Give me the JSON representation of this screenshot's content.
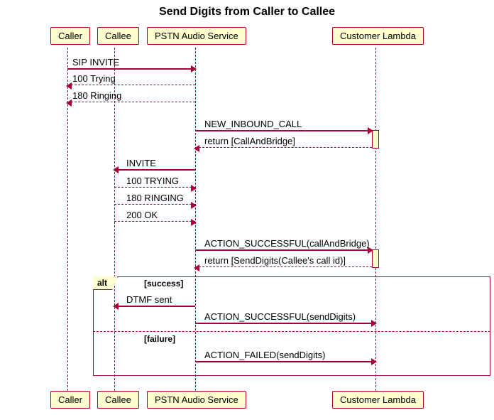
{
  "title": "Send Digits from Caller to Callee",
  "participants": {
    "caller": "Caller",
    "callee": "Callee",
    "pstn": "PSTN Audio Service",
    "lambda": "Customer Lambda"
  },
  "messages": {
    "m1": "SIP INVITE",
    "m2": "100 Trying",
    "m3": "180 Ringing",
    "m4": "NEW_INBOUND_CALL",
    "m5": "return [CallAndBridge]",
    "m6": "INVITE",
    "m7": "100 TRYING",
    "m8": "180 RINGING",
    "m9": "200 OK",
    "m10": "ACTION_SUCCESSFUL(callAndBridge)",
    "m11": "return [SendDigits(Callee's call id)]",
    "m12": "DTMF sent",
    "m13": "ACTION_SUCCESSFUL(sendDigits)",
    "m14": "ACTION_FAILED(sendDigits)"
  },
  "alt": {
    "label": "alt",
    "success": "[success]",
    "failure": "[failure]"
  }
}
